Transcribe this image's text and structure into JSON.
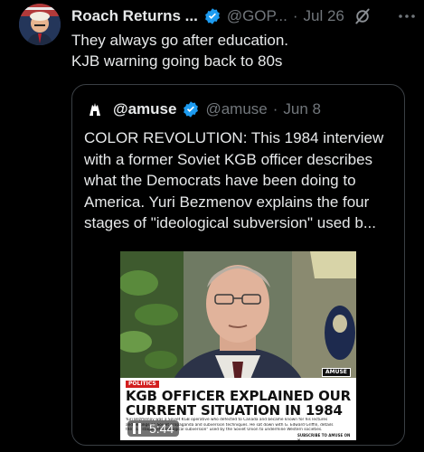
{
  "author": {
    "name": "Roach Returns ...",
    "handle": "@GOP...",
    "separator": "·",
    "time": "Jul 26",
    "verified_color": "#1d9bf0"
  },
  "icons": {
    "verified": "verified-badge-icon",
    "grok": "grok-icon",
    "more": "more-options-icon",
    "pause": "pause-icon"
  },
  "tweet": {
    "lines": [
      "They always go after education.",
      "KJB warning going back to 80s"
    ]
  },
  "quote": {
    "name": "@amuse",
    "handle": "@amuse",
    "separator": "·",
    "time": "Jun 8",
    "lines": [
      "COLOR REVOLUTION: This 1984 interview",
      "with a former Soviet KGB officer describes",
      "what the Democrats have been doing to",
      "America. Yuri Bezmenov explains the four",
      "stages of \"ideological subversion\" used b..."
    ],
    "video": {
      "tag": "POLITICS",
      "brand": "AMUSE",
      "headline_lines": [
        "KGB OFFICER EXPLAINED OUR",
        "CURRENT SITUATION IN 1984"
      ],
      "caption_lines": [
        "Yuri Bezmenov was a Soviet KGB operative who defected to Canada and became known for his lectures",
        "and writings on Soviet propaganda and subversion techniques. He sat down with G. Edward Griffin, details",
        "the four stages of \"ideological subversion\" used by the Soviet Union to undermine Western societies."
      ],
      "cta": "SUBSCRIBE TO AMUSE ON X",
      "time": "5:44"
    }
  }
}
